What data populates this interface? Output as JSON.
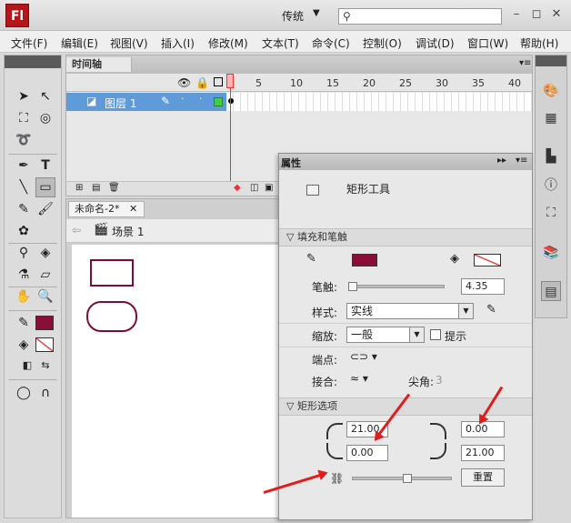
{
  "app": {
    "logo_text": "Fl",
    "workspace": "传统",
    "search_placeholder": ""
  },
  "menu": [
    "文件(F)",
    "编辑(E)",
    "视图(V)",
    "插入(I)",
    "修改(M)",
    "文本(T)",
    "命令(C)",
    "控制(O)",
    "调试(D)",
    "窗口(W)",
    "帮助(H)"
  ],
  "timeline": {
    "tab": "时间轴",
    "frame_numbers": [
      "1",
      "5",
      "10",
      "15",
      "20",
      "25",
      "30",
      "35",
      "40",
      "4"
    ],
    "layer_name": "图层 1"
  },
  "document": {
    "tab": "未命名-2*",
    "scene": "场景 1"
  },
  "colors": {
    "stroke": "#8b0d3a",
    "shape_stroke": "#7a0e36",
    "arrow": "#e21b1b",
    "layer_selected": "#5f9bd8",
    "layer_outline": "#44cc44"
  },
  "properties": {
    "tab": "属性",
    "tool_name": "矩形工具",
    "fill_stroke_section": "填充和笔触",
    "stroke_label": "笔触:",
    "stroke_value": "4.35",
    "style_label": "样式:",
    "style_value": "实线",
    "scale_label": "缩放:",
    "scale_value": "一般",
    "hint_label": "提示",
    "cap_label": "端点:",
    "join_label": "接合:",
    "miter_label": "尖角:",
    "miter_value": "3",
    "rect_section": "矩形选项",
    "corner_tl": "21.00",
    "corner_tr": "0.00",
    "corner_bl": "0.00",
    "corner_br": "21.00",
    "reset_label": "重置"
  }
}
